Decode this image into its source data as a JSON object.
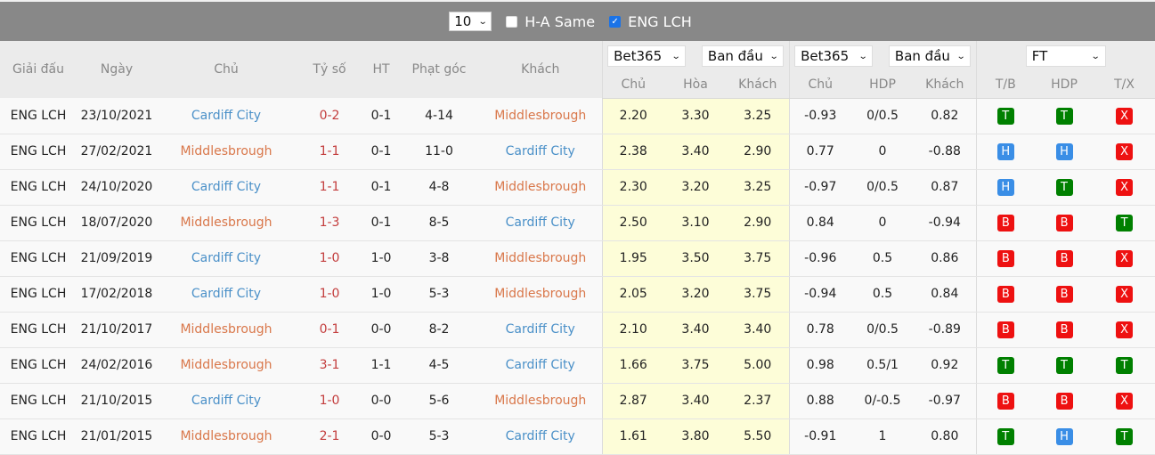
{
  "topbar": {
    "count_value": "10",
    "ha_same_label": "H-A Same",
    "ha_same_checked": false,
    "league_label": "ENG LCH",
    "league_checked": true
  },
  "header": {
    "league": "Giải đấu",
    "date": "Ngày",
    "home": "Chủ",
    "score": "Tỷ số",
    "ht": "HT",
    "corners": "Phạt góc",
    "away": "Khách",
    "odds1_bookmaker": "Bet365",
    "odds1_type": "Ban đầu",
    "odds2_bookmaker": "Bet365",
    "odds2_type": "Ban đầu",
    "result_filter": "FT",
    "odds1_cols": [
      "Chủ",
      "Hòa",
      "Khách"
    ],
    "odds2_cols": [
      "Chủ",
      "HDP",
      "Khách"
    ],
    "result_cols": [
      "T/B",
      "HDP",
      "T/X"
    ]
  },
  "colors": {
    "home_team_cardiff": "#4a90c8",
    "team_middlesbrough": "#d9774a",
    "score": "#c33d3d",
    "badge_T": "#008000",
    "badge_H": "#3a8ee6",
    "badge_B": "#ee1111",
    "badge_X": "#ee1111",
    "odds_highlight": "#fdfdd8"
  },
  "rows": [
    {
      "league": "ENG LCH",
      "date": "23/10/2021",
      "home": "Cardiff City",
      "score": "0-2",
      "ht": "0-1",
      "corners": "4-14",
      "away": "Middlesbrough",
      "o1_home": "2.20",
      "o1_draw": "3.30",
      "o1_away": "3.25",
      "o2_home": "-0.93",
      "o2_hdp": "0/0.5",
      "o2_away": "0.82",
      "tb": "T",
      "hdp": "T",
      "tx": "X"
    },
    {
      "league": "ENG LCH",
      "date": "27/02/2021",
      "home": "Middlesbrough",
      "score": "1-1",
      "ht": "0-1",
      "corners": "11-0",
      "away": "Cardiff City",
      "o1_home": "2.38",
      "o1_draw": "3.40",
      "o1_away": "2.90",
      "o2_home": "0.77",
      "o2_hdp": "0",
      "o2_away": "-0.88",
      "tb": "H",
      "hdp": "H",
      "tx": "X"
    },
    {
      "league": "ENG LCH",
      "date": "24/10/2020",
      "home": "Cardiff City",
      "score": "1-1",
      "ht": "0-1",
      "corners": "4-8",
      "away": "Middlesbrough",
      "o1_home": "2.30",
      "o1_draw": "3.20",
      "o1_away": "3.25",
      "o2_home": "-0.97",
      "o2_hdp": "0/0.5",
      "o2_away": "0.87",
      "tb": "H",
      "hdp": "T",
      "tx": "X"
    },
    {
      "league": "ENG LCH",
      "date": "18/07/2020",
      "home": "Middlesbrough",
      "score": "1-3",
      "ht": "0-1",
      "corners": "8-5",
      "away": "Cardiff City",
      "o1_home": "2.50",
      "o1_draw": "3.10",
      "o1_away": "2.90",
      "o2_home": "0.84",
      "o2_hdp": "0",
      "o2_away": "-0.94",
      "tb": "B",
      "hdp": "B",
      "tx": "T"
    },
    {
      "league": "ENG LCH",
      "date": "21/09/2019",
      "home": "Cardiff City",
      "score": "1-0",
      "ht": "1-0",
      "corners": "3-8",
      "away": "Middlesbrough",
      "o1_home": "1.95",
      "o1_draw": "3.50",
      "o1_away": "3.75",
      "o2_home": "-0.96",
      "o2_hdp": "0.5",
      "o2_away": "0.86",
      "tb": "B",
      "hdp": "B",
      "tx": "X"
    },
    {
      "league": "ENG LCH",
      "date": "17/02/2018",
      "home": "Cardiff City",
      "score": "1-0",
      "ht": "1-0",
      "corners": "5-3",
      "away": "Middlesbrough",
      "o1_home": "2.05",
      "o1_draw": "3.20",
      "o1_away": "3.75",
      "o2_home": "-0.94",
      "o2_hdp": "0.5",
      "o2_away": "0.84",
      "tb": "B",
      "hdp": "B",
      "tx": "X"
    },
    {
      "league": "ENG LCH",
      "date": "21/10/2017",
      "home": "Middlesbrough",
      "score": "0-1",
      "ht": "0-0",
      "corners": "8-2",
      "away": "Cardiff City",
      "o1_home": "2.10",
      "o1_draw": "3.40",
      "o1_away": "3.40",
      "o2_home": "0.78",
      "o2_hdp": "0/0.5",
      "o2_away": "-0.89",
      "tb": "B",
      "hdp": "B",
      "tx": "X"
    },
    {
      "league": "ENG LCH",
      "date": "24/02/2016",
      "home": "Middlesbrough",
      "score": "3-1",
      "ht": "1-1",
      "corners": "4-5",
      "away": "Cardiff City",
      "o1_home": "1.66",
      "o1_draw": "3.75",
      "o1_away": "5.00",
      "o2_home": "0.98",
      "o2_hdp": "0.5/1",
      "o2_away": "0.92",
      "tb": "T",
      "hdp": "T",
      "tx": "T"
    },
    {
      "league": "ENG LCH",
      "date": "21/10/2015",
      "home": "Cardiff City",
      "score": "1-0",
      "ht": "0-0",
      "corners": "5-6",
      "away": "Middlesbrough",
      "o1_home": "2.87",
      "o1_draw": "3.40",
      "o1_away": "2.37",
      "o2_home": "0.88",
      "o2_hdp": "0/-0.5",
      "o2_away": "-0.97",
      "tb": "B",
      "hdp": "B",
      "tx": "X"
    },
    {
      "league": "ENG LCH",
      "date": "21/01/2015",
      "home": "Middlesbrough",
      "score": "2-1",
      "ht": "0-0",
      "corners": "5-3",
      "away": "Cardiff City",
      "o1_home": "1.61",
      "o1_draw": "3.80",
      "o1_away": "5.50",
      "o2_home": "-0.91",
      "o2_hdp": "1",
      "o2_away": "0.80",
      "tb": "T",
      "hdp": "H",
      "tx": "T"
    }
  ]
}
